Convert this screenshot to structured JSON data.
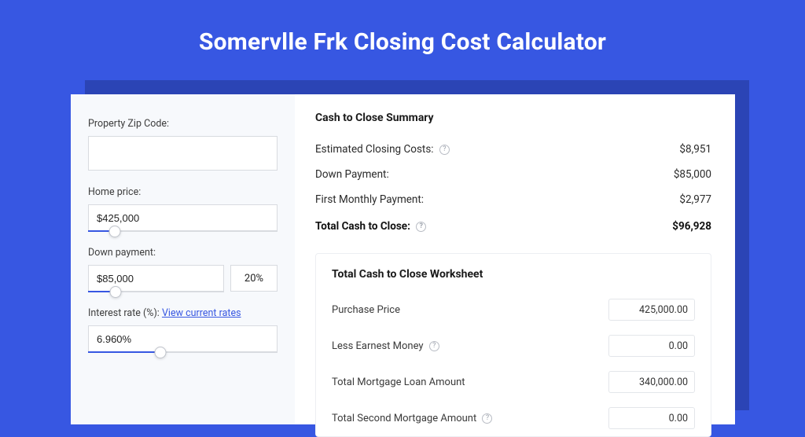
{
  "page": {
    "title": "Somervlle Frk Closing Cost Calculator"
  },
  "form": {
    "zip": {
      "label": "Property Zip Code:",
      "value": ""
    },
    "home_price": {
      "label": "Home price:",
      "value": "$425,000",
      "slider_pct": 14
    },
    "down_payment": {
      "label": "Down payment:",
      "value": "$85,000",
      "pct": "20%",
      "slider_pct": 20
    },
    "interest": {
      "label": "Interest rate (%):",
      "link": "View current rates",
      "value": "6.960%",
      "slider_pct": 38
    }
  },
  "summary": {
    "title": "Cash to Close Summary",
    "rows": {
      "closing_costs": {
        "label": "Estimated Closing Costs:",
        "value": "$8,951",
        "help": true
      },
      "down_payment": {
        "label": "Down Payment:",
        "value": "$85,000",
        "help": false
      },
      "first_payment": {
        "label": "First Monthly Payment:",
        "value": "$2,977",
        "help": false
      },
      "total": {
        "label": "Total Cash to Close:",
        "value": "$96,928",
        "help": true
      }
    }
  },
  "worksheet": {
    "title": "Total Cash to Close Worksheet",
    "rows": {
      "purchase": {
        "label": "Purchase Price",
        "value": "425,000.00",
        "help": false
      },
      "earnest": {
        "label": "Less Earnest Money",
        "value": "0.00",
        "help": true
      },
      "mortgage": {
        "label": "Total Mortgage Loan Amount",
        "value": "340,000.00",
        "help": false
      },
      "second": {
        "label": "Total Second Mortgage Amount",
        "value": "0.00",
        "help": true
      }
    }
  },
  "glyphs": {
    "help": "?"
  }
}
